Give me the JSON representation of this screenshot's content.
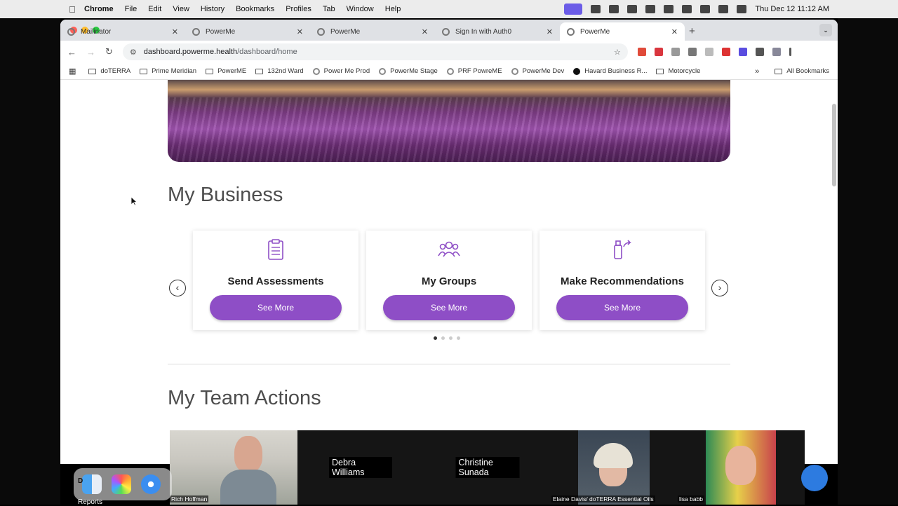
{
  "menubar": {
    "app": "Chrome",
    "items": [
      "File",
      "Edit",
      "View",
      "History",
      "Bookmarks",
      "Profiles",
      "Tab",
      "Window",
      "Help"
    ],
    "clock": "Thu Dec 12  11:12 AM"
  },
  "tabs": [
    {
      "label": "Mailinator",
      "active": false
    },
    {
      "label": "PowerMe",
      "active": false
    },
    {
      "label": "PowerMe",
      "active": false
    },
    {
      "label": "Sign In with Auth0",
      "active": false
    },
    {
      "label": "PowerMe",
      "active": true
    }
  ],
  "address": {
    "host": "dashboard.powerme.health",
    "path": "/dashboard/home"
  },
  "bookmarks": {
    "items": [
      {
        "label": "doTERRA",
        "type": "folder"
      },
      {
        "label": "Prime Meridian",
        "type": "folder"
      },
      {
        "label": "PowerME",
        "type": "folder"
      },
      {
        "label": "132nd Ward",
        "type": "folder"
      },
      {
        "label": "Power Me Prod",
        "type": "site"
      },
      {
        "label": "PowerMe Stage",
        "type": "site"
      },
      {
        "label": "PRF PowreME",
        "type": "site"
      },
      {
        "label": "PowerMe Dev",
        "type": "site"
      },
      {
        "label": "Havard Business R...",
        "type": "site-dark"
      },
      {
        "label": "Motorcycle",
        "type": "folder"
      }
    ],
    "all": "All Bookmarks"
  },
  "page": {
    "business_title": "My Business",
    "team_title": "My Team Actions",
    "cards": [
      {
        "title": "Send Assessments",
        "button": "See More",
        "icon": "clipboard-icon"
      },
      {
        "title": "My Groups",
        "button": "See More",
        "icon": "group-icon"
      },
      {
        "title": "Make Recommendations",
        "button": "See More",
        "icon": "bottle-share-icon"
      }
    ],
    "carousel_pages": 4,
    "carousel_active": 0
  },
  "video_call": {
    "participants": [
      {
        "name": "Rich Hoffman",
        "video": true
      },
      {
        "name": "Debra Williams",
        "video": false
      },
      {
        "name": "Christine Sunada",
        "video": false
      },
      {
        "name": "Elaine Davis/ doTERRA Essential Oils",
        "video": true
      },
      {
        "name": "lisa babb",
        "video": true
      }
    ]
  },
  "dock": {
    "label_left": "D",
    "label_bottom": "Reports"
  },
  "colors": {
    "accent": "#8e4ec6",
    "heading": "#4d4d4d"
  }
}
